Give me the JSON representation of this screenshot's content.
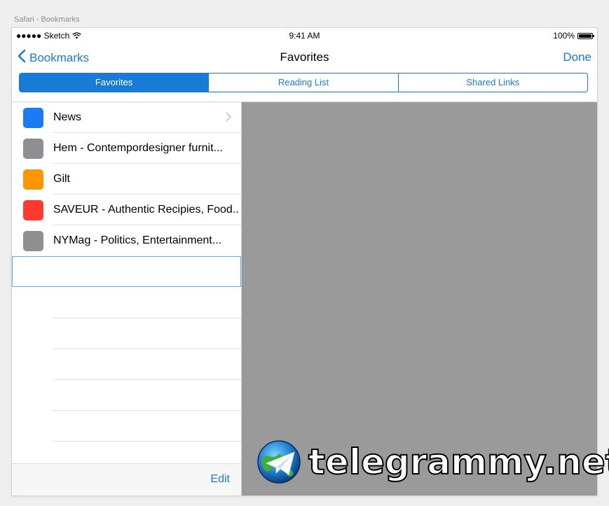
{
  "window_title": "Safari - Bookmarks",
  "status_bar": {
    "carrier": "●●●●● Sketch",
    "time": "9:41 AM",
    "battery": "100%"
  },
  "nav": {
    "back_label": "Bookmarks",
    "title": "Favorites",
    "done_label": "Done"
  },
  "segments": [
    "Favorites",
    "Reading List",
    "Shared Links"
  ],
  "bookmarks": [
    {
      "label": "News",
      "color": "#1a7bf4",
      "has_chevron": true
    },
    {
      "label": "Hem - Contempordesigner furnit...",
      "color": "#8e8e93",
      "has_chevron": false
    },
    {
      "label": "Gilt",
      "color": "#ff9500",
      "has_chevron": false
    },
    {
      "label": "SAVEUR - Authentic Recipies, Food...",
      "color": "#ff3b30",
      "has_chevron": false
    },
    {
      "label": "NYMag - Politics, Entertainment...",
      "color": "#8e8e93",
      "has_chevron": false
    }
  ],
  "toolbar": {
    "edit_label": "Edit"
  },
  "watermark": {
    "text": "telegrammy.net"
  },
  "colors": {
    "accent": "#1a7bd6",
    "detail_bg": "#9a9a9a"
  }
}
